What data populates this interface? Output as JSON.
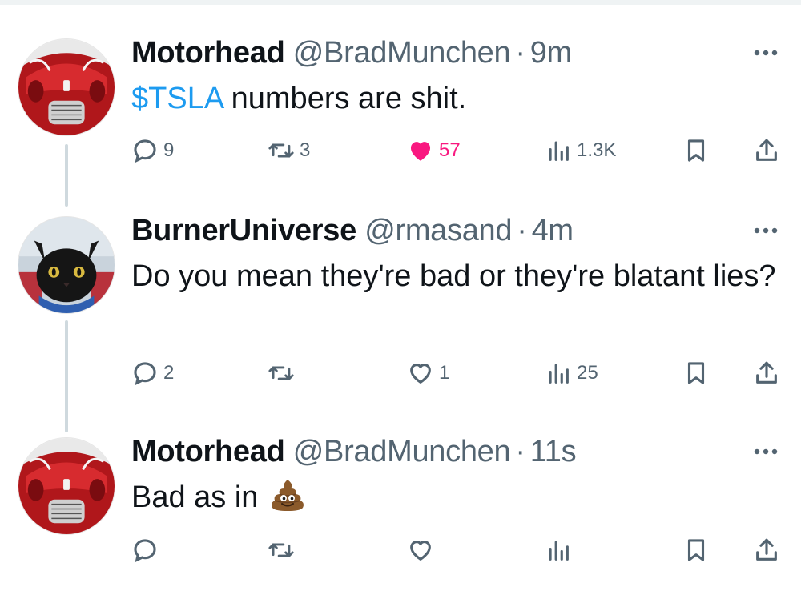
{
  "tweets": [
    {
      "name": "Motorhead",
      "handle": "@BradMunchen",
      "separator": "·",
      "time": "9m",
      "text_cashtag": "$TSLA",
      "text": " numbers are shit.",
      "replies": "9",
      "retweets": "3",
      "likes": "57",
      "views": "1.3K",
      "liked": true
    },
    {
      "name": "BurnerUniverse",
      "handle": "@rmasand",
      "separator": "·",
      "time": "4m",
      "text": "Do you mean they're bad or they're blatant lies?",
      "replies": "2",
      "retweets": "",
      "likes": "1",
      "views": "25",
      "liked": false
    },
    {
      "name": "Motorhead",
      "handle": "@BradMunchen",
      "separator": "·",
      "time": "11s",
      "text": "Bad as in",
      "replies": "",
      "retweets": "",
      "likes": "",
      "views": "",
      "liked": false
    }
  ],
  "icons": {
    "reply": "reply-icon",
    "retweet": "retweet-icon",
    "like": "heart-icon",
    "views": "views-chart-icon",
    "bookmark": "bookmark-icon",
    "share": "share-icon",
    "more": "more-dots-icon",
    "emoji": "poop-emoji-icon"
  },
  "colors": {
    "cashtag": "#1d9bf0",
    "like_active": "#f91880",
    "secondary": "#536471",
    "thread_line": "#cfd9de"
  }
}
